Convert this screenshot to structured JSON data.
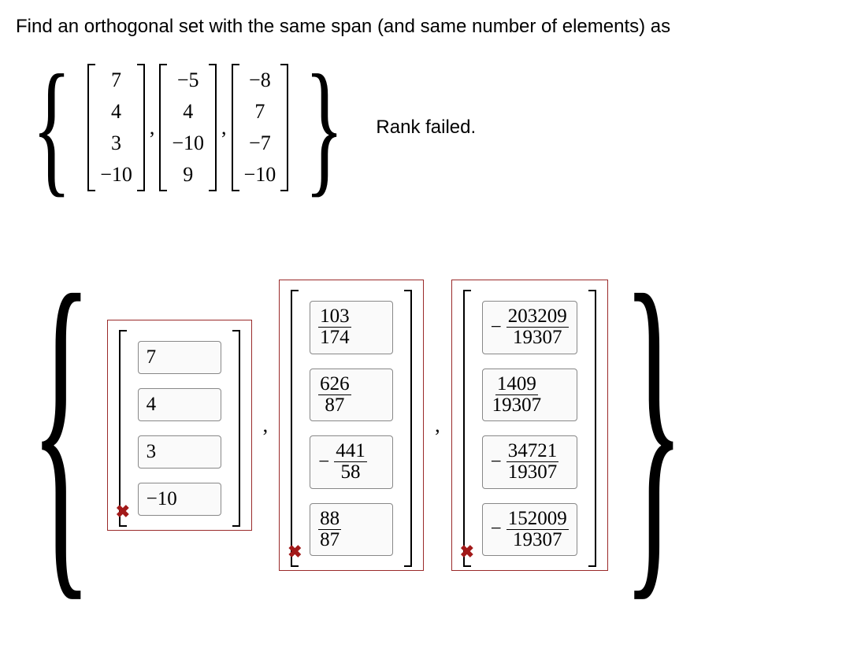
{
  "prompt": "Find an orthogonal set with the same span (and same number of elements) as",
  "given": {
    "v1": [
      "7",
      "4",
      "3",
      "−10"
    ],
    "v2": [
      "−5",
      "4",
      "−10",
      "9"
    ],
    "v3": [
      "−8",
      "7",
      "−7",
      "−10"
    ]
  },
  "feedback": "Rank failed.",
  "answers": {
    "a1": [
      "7",
      "4",
      "3",
      "−10"
    ],
    "a2": [
      {
        "num": "103",
        "den": "174",
        "neg": false
      },
      {
        "num": "626",
        "den": "87",
        "neg": false
      },
      {
        "num": "441",
        "den": "58",
        "neg": true
      },
      {
        "num": "88",
        "den": "87",
        "neg": false
      }
    ],
    "a3": [
      {
        "num": "203209",
        "den": "19307",
        "neg": true
      },
      {
        "num": "1409",
        "den": "19307",
        "neg": false
      },
      {
        "num": "34721",
        "den": "19307",
        "neg": true
      },
      {
        "num": "152009",
        "den": "19307",
        "neg": true
      }
    ]
  },
  "icons": {
    "cross": "✖"
  },
  "minus": "−"
}
